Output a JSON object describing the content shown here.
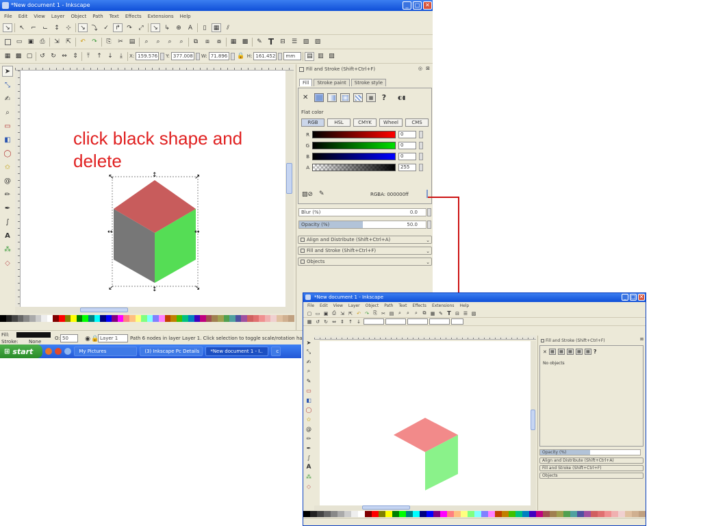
{
  "colors": {
    "xp_title": "#0f4fd8",
    "face_top": "#c85c5c",
    "face_left": "#777777",
    "face_right": "#55dd55",
    "annotation": "#e02020",
    "arrow": "#cc1111",
    "top_faded": "#f28a8a",
    "right_faded": "#8af28a"
  },
  "annotation": {
    "line1": "click black shape and",
    "line2": "delete"
  },
  "win1": {
    "title": "*New document 1 - Inkscape",
    "menu": [
      "File",
      "Edit",
      "View",
      "Layer",
      "Object",
      "Path",
      "Text",
      "Effects",
      "Extensions",
      "Help"
    ],
    "controls": {
      "x": "159.576",
      "y": "377.008",
      "w": "71.896",
      "h": "161.452",
      "unit": "mm",
      "x_lbl": "X:",
      "y_lbl": "Y:",
      "w_lbl": "W:",
      "h_lbl": "H:"
    },
    "dialog": {
      "title": "Fill and Stroke (Shift+Ctrl+F)",
      "tabs": [
        "Fill",
        "Stroke paint",
        "Stroke style"
      ],
      "flat_color": "Flat color",
      "modes": [
        "RGB",
        "HSL",
        "CMYK",
        "Wheel",
        "CMS"
      ],
      "channels": [
        {
          "label": "R",
          "value": "0"
        },
        {
          "label": "G",
          "value": "0"
        },
        {
          "label": "B",
          "value": "0"
        },
        {
          "label": "A",
          "value": "255"
        }
      ],
      "rgba": "RGBA: 000000ff",
      "blur_label": "Blur (%)",
      "blur_value": "0.0",
      "opacity_label": "Opacity (%)",
      "opacity_value": "50.0",
      "opacity": 0.5,
      "docked": [
        "Align and Distribute (Shift+Ctrl+A)",
        "Fill and Stroke (Shift+Ctrl+F)",
        "Objects"
      ]
    },
    "status": {
      "fill_lbl": "Fill:",
      "stroke_lbl": "Stroke:",
      "stroke_val": "None",
      "opacity_lbl": "O:",
      "opacity_val": "50",
      "layer": "Layer 1",
      "message": "Path 6 nodes in layer Layer 1. Click selection to toggle scale/rotation handles."
    }
  },
  "taskbar": {
    "start": "start",
    "items": [
      "My Pictures",
      "(3) Inkscape Pc Details",
      "*New document 1 - I..",
      "c"
    ]
  },
  "win2": {
    "title": "*New document 1 - Inkscape",
    "menu": [
      "File",
      "Edit",
      "View",
      "Layer",
      "Object",
      "Path",
      "Text",
      "Effects",
      "Extensions",
      "Help"
    ],
    "dialog_title": "Fill and Stroke (Shift+Ctrl+F)",
    "no_objects": "No objects",
    "opacity_label": "Opacity (%)",
    "docked": [
      "Align and Distribute (Shift+Ctrl+A)",
      "Fill and Stroke (Shift+Ctrl+F)",
      "Objects"
    ]
  }
}
